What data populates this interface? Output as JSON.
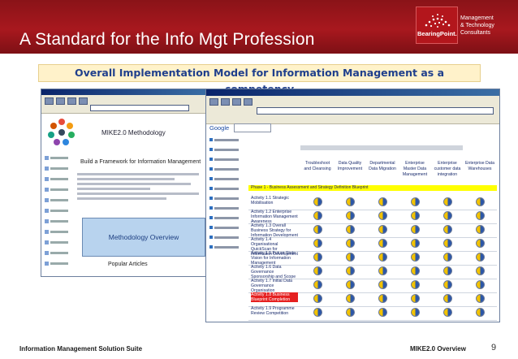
{
  "slide": {
    "title": "A Standard for the Info Mgt Profession",
    "subtitle": "Overall Implementation Model for Information Management as a competency",
    "brand": {
      "name": "BearingPoint.",
      "subtext": "Management\n& Technology\nConsultants"
    },
    "footer": {
      "left": "Information Management Solution Suite",
      "right": "MIKE2.0 Overview",
      "page": "9"
    },
    "accent_color": "#a8181e",
    "subtitle_bg": "#fff2ca"
  },
  "left_screenshot": {
    "site_title": "MIKE2.0 Methodology",
    "heading": "Build a Framework for Information Management",
    "banner": "Methodology Overview",
    "popular": "Popular Articles"
  },
  "right_screenshot": {
    "search_label": "Google",
    "matrix": {
      "columns": [
        "Troubleshoot and Cleansing",
        "Data Quality Improvement",
        "Departmental Data Migration",
        "Enterprise Master Data Management",
        "Enterprise customer data integration",
        "Enterprise Data Warehouses"
      ],
      "phase_label": "Phase 1 - Business Assessment and Strategy Definition Blueprint",
      "rows": [
        {
          "label": "Activity 1.1 Strategic Mobilisation",
          "highlight": false
        },
        {
          "label": "Activity 1.2 Enterprise Information Management Awareness",
          "highlight": false
        },
        {
          "label": "Activity 1.3 Overall Business Strategy for Information Development",
          "highlight": false
        },
        {
          "label": "Activity 1.4 Organisational QuickScan for Information Development",
          "highlight": false
        },
        {
          "label": "Activity 1.5 Future State Vision for Information Management",
          "highlight": false
        },
        {
          "label": "Activity 1.6 Data Governance Sponsorship and Scope",
          "highlight": false
        },
        {
          "label": "Activity 1.7 Initial Data Governance Organisation",
          "highlight": false
        },
        {
          "label": "Activity 1.8 Business Blueprint Completion",
          "highlight": true
        },
        {
          "label": "Activity 1.9 Programme Review Competition",
          "highlight": false
        }
      ]
    }
  }
}
